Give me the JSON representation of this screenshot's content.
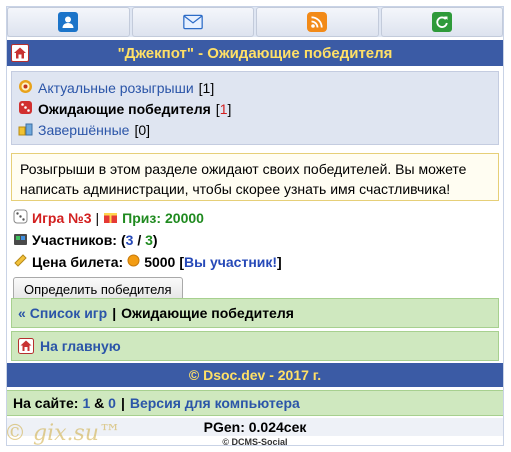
{
  "nav": {
    "icons": [
      "user-icon",
      "mail-icon",
      "rss-icon",
      "refresh-icon"
    ]
  },
  "header": {
    "title": "\"Джекпот\" - Ожидающие победителя"
  },
  "menu": {
    "items": [
      {
        "label": "Актуальные розыгрыши",
        "count": "1"
      },
      {
        "label": "Ожидающие победителя",
        "count": "1"
      },
      {
        "label": "Завершённые",
        "count": "0"
      }
    ]
  },
  "notice": {
    "text": "Розыгрыши в этом разделе ожидают своих победителей. Вы можете написать администрации, чтобы скорее узнать имя счастливчика!"
  },
  "game": {
    "number_label": "Игра №3",
    "prize_label": "Приз:",
    "prize_value": "20000",
    "participants_label": "Участников:",
    "participants_current": "3",
    "participants_total": "3",
    "ticket_label": "Цена билета:",
    "ticket_value": "5000",
    "participant_status": "Вы участник!",
    "determine_button": "Определить победителя"
  },
  "breadcrumb": {
    "back_label": "Список игр",
    "current": "Ожидающие победителя"
  },
  "home": {
    "label": "На главную"
  },
  "footer": {
    "copyright": "© Dsoc.dev - 2017 г.",
    "online_label": "На сайте:",
    "online_users": "1",
    "online_guests": "0",
    "desktop_version": "Версия для компьютера",
    "pgen": "PGen: 0.024сек",
    "engine": "© DCMS-Social"
  },
  "watermark": "© gix.su™",
  "colors": {
    "header_bg": "#3b5ba5",
    "header_text": "#ffe066",
    "link": "#2b55a8",
    "green_bg": "#cfe8bf",
    "accent_red": "#d21f1f",
    "accent_green": "#1f8a1f"
  }
}
